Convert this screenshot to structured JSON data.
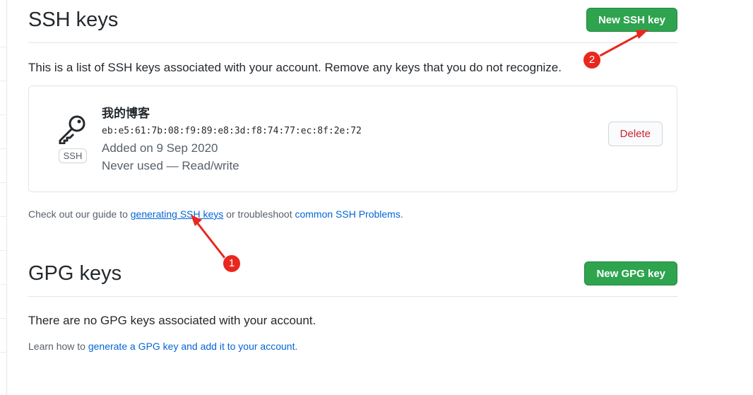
{
  "ssh": {
    "title": "SSH keys",
    "new_button": "New SSH key",
    "description": "This is a list of SSH keys associated with your account. Remove any keys that you do not recognize.",
    "key": {
      "badge": "SSH",
      "name": "我的博客",
      "fingerprint": "eb:e5:61:7b:08:f9:89:e8:3d:f8:74:77:ec:8f:2e:72",
      "added": "Added on 9 Sep 2020",
      "usage": "Never used — Read/write",
      "delete_button": "Delete"
    },
    "help": {
      "prefix": "Check out our guide to ",
      "link1": "generating SSH keys",
      "middle": " or troubleshoot ",
      "link2": "common SSH Problems",
      "suffix": "."
    }
  },
  "gpg": {
    "title": "GPG keys",
    "new_button": "New GPG key",
    "empty": "There are no GPG keys associated with your account.",
    "help_prefix": "Learn how to ",
    "help_link": "generate a GPG key and add it to your account",
    "help_suffix": "."
  },
  "annotations": [
    {
      "label": "1"
    },
    {
      "label": "2"
    }
  ],
  "colors": {
    "primary": "#2ea44f",
    "danger": "#cb2431",
    "link": "#0366d6",
    "annotation": "#e8281f"
  }
}
